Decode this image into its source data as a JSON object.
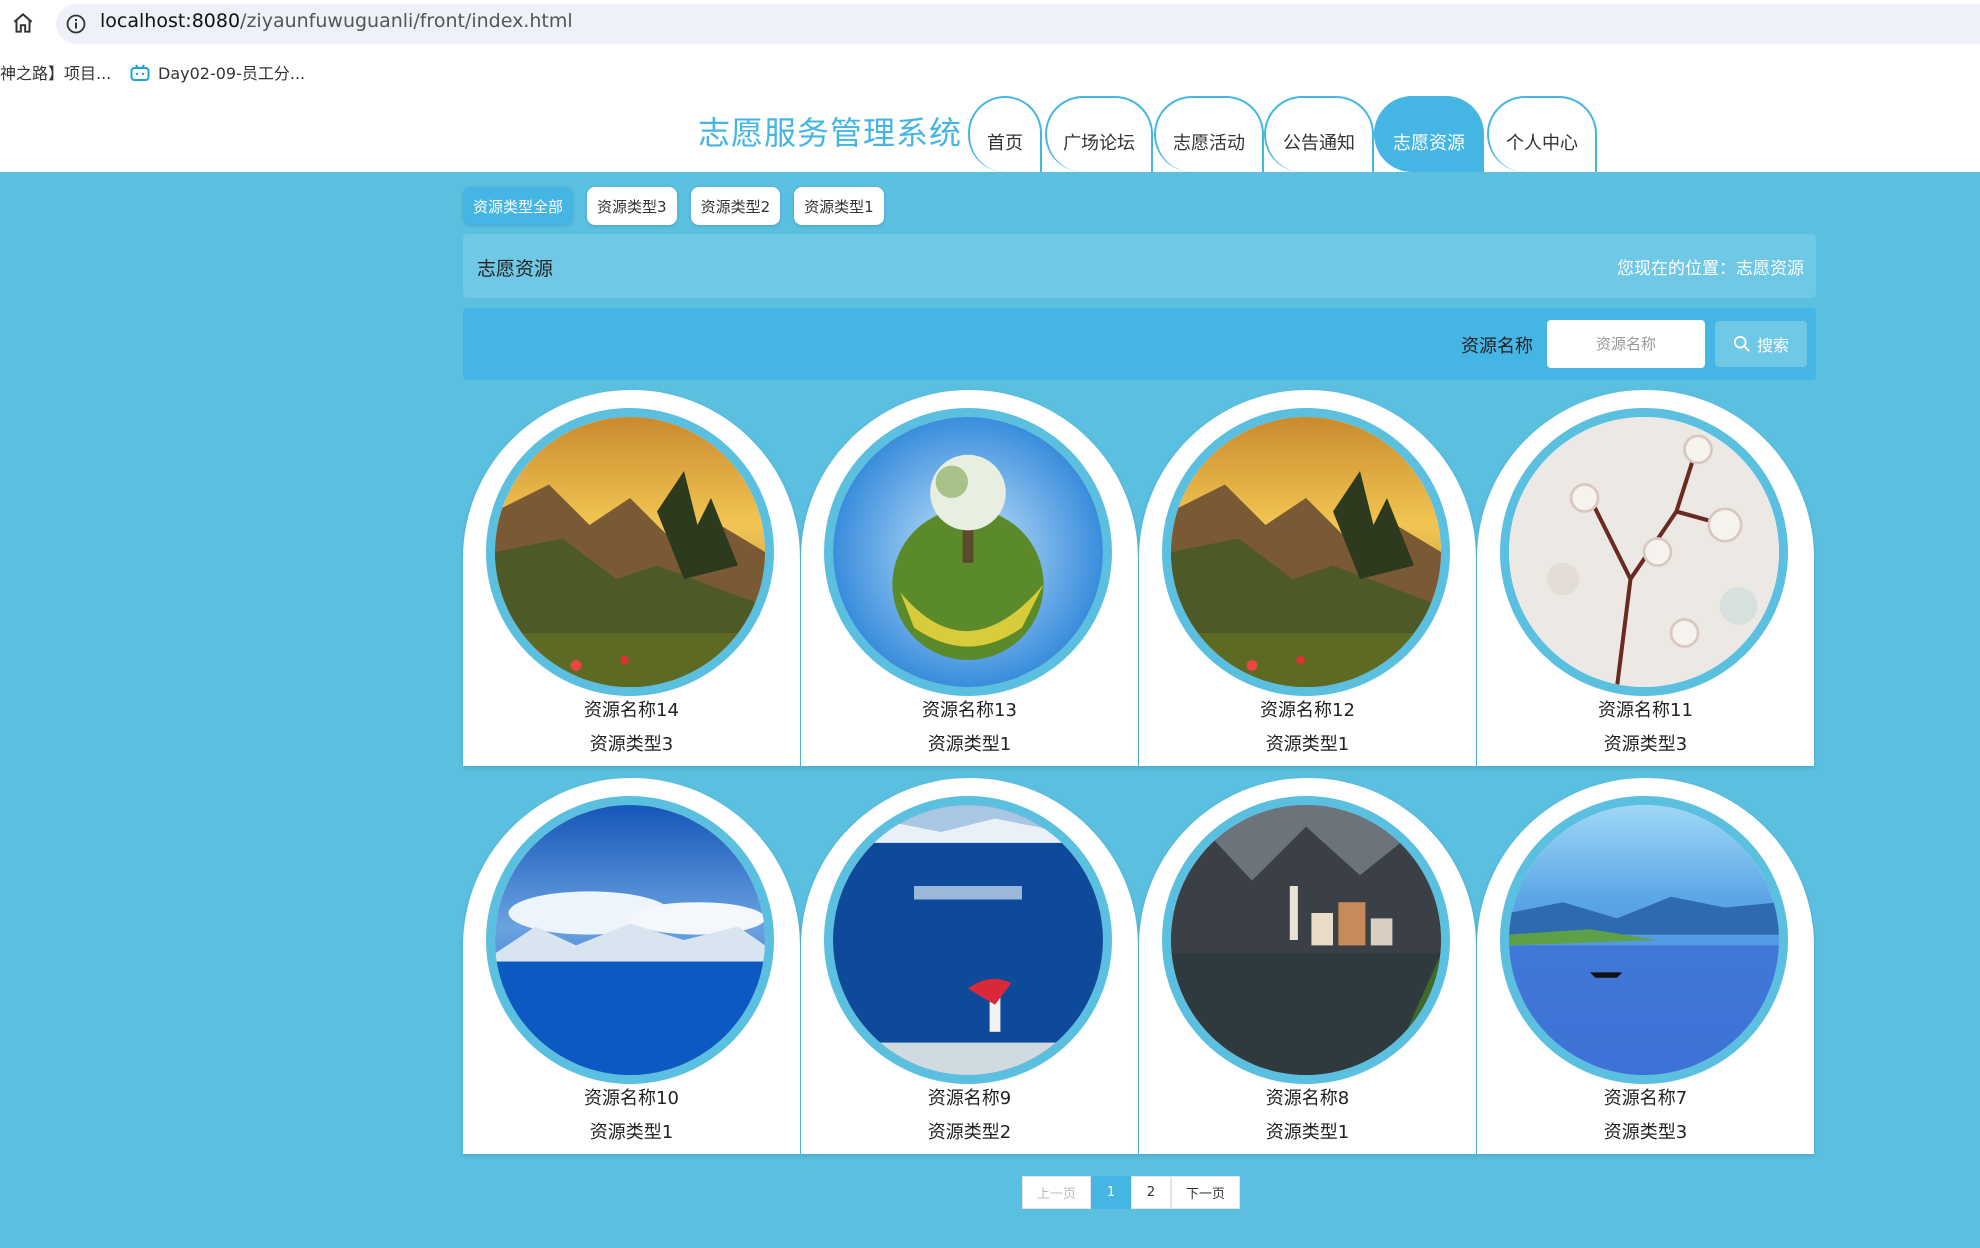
{
  "browser": {
    "url_host": "localhost:8080",
    "url_path": "/ziyaunfuwuguanli/front/index.html",
    "bookmarks": [
      "神之路】项目...",
      "Day02-09-员工分..."
    ]
  },
  "site": {
    "title": "志愿服务管理系统",
    "nav": [
      "首页",
      "广场论坛",
      "志愿活动",
      "公告通知",
      "志愿资源",
      "个人中心"
    ],
    "active_nav": "志愿资源"
  },
  "filters": {
    "items": [
      "资源类型全部",
      "资源类型3",
      "资源类型2",
      "资源类型1"
    ],
    "active": "资源类型全部"
  },
  "breadcrumb": {
    "title": "志愿资源",
    "position": "您现在的位置：志愿资源"
  },
  "search": {
    "label": "资源名称",
    "placeholder": "资源名称",
    "button": "搜索"
  },
  "cards": [
    {
      "name": "资源名称14",
      "type": "资源类型3",
      "image": "mountain-sunset"
    },
    {
      "name": "资源名称13",
      "type": "资源类型1",
      "image": "tiny-planet-tree"
    },
    {
      "name": "资源名称12",
      "type": "资源类型1",
      "image": "mountain-sunset"
    },
    {
      "name": "资源名称11",
      "type": "资源类型3",
      "image": "cherry-blossom"
    },
    {
      "name": "资源名称10",
      "type": "资源类型1",
      "image": "blue-lake-snow-mountains"
    },
    {
      "name": "资源名称9",
      "type": "资源类型2",
      "image": "sayram-lake-girl"
    },
    {
      "name": "资源名称8",
      "type": "资源类型1",
      "image": "hallstatt-village"
    },
    {
      "name": "资源名称7",
      "type": "资源类型3",
      "image": "lake-boat"
    }
  ],
  "pagination": {
    "prev": "上一页",
    "pages": [
      "1",
      "2"
    ],
    "current": "1",
    "next": "下一页"
  },
  "colors": {
    "accent": "#45b6e3",
    "background": "#5bbfe0",
    "crumb_bg": "#6fc8e5"
  }
}
